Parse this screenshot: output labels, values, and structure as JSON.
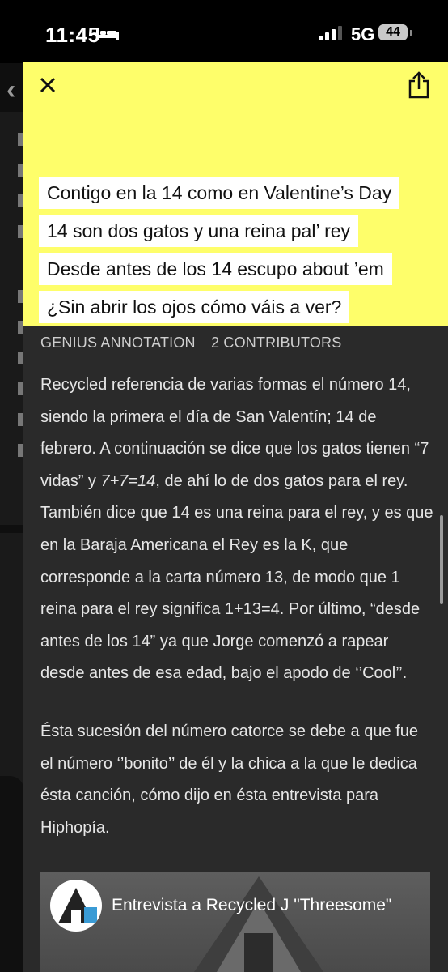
{
  "status_bar": {
    "time": "11:45",
    "network": "5G",
    "battery": "44"
  },
  "annotation": {
    "lyrics": [
      "Contigo en la 14 como en Valentine’s Day",
      "14 son dos gatos y una reina pal’ rey",
      "Desde antes de los 14 escupo about ’em",
      "¿Sin abrir los ojos cómo váis a ver?"
    ],
    "meta": {
      "type": "GENIUS ANNOTATION",
      "contributors": "2 CONTRIBUTORS"
    },
    "body": {
      "p1_a": "Recycled referencia de varias formas el número 14, siendo la primera el día de San Valentín; 14 de febrero. A continuación se dice que los gatos tienen “7 vidas” y ",
      "p1_em": "7+7=14",
      "p1_b": ", de ahí lo de dos gatos para el rey. También dice que 14 es una reina para el rey, y es que en la Baraja Americana el Rey es la K, que corresponde a la carta número 13, de modo que 1 reina para el rey significa 1+13=4. Por último, “desde antes de los 14” ya que Jorge comenzó a rapear desde antes de esa edad, bajo el apodo de ‘’Cool’’.",
      "p2": "Ésta sucesión del número catorce se debe a que fue el número ‘’bonito’’ de él y la chica a la que le dedica ésta canción, cómo dijo en ésta entrevista para Hiphopía."
    },
    "video": {
      "title": "Entrevista a Recycled J \"Threesome\""
    }
  },
  "colors": {
    "lyric_card": "#fefe6a",
    "panel": "#2a2a2a",
    "background": "#000000"
  },
  "icons": [
    "bed-icon",
    "signal-icon",
    "close-icon",
    "share-icon",
    "back-chevron-icon"
  ]
}
